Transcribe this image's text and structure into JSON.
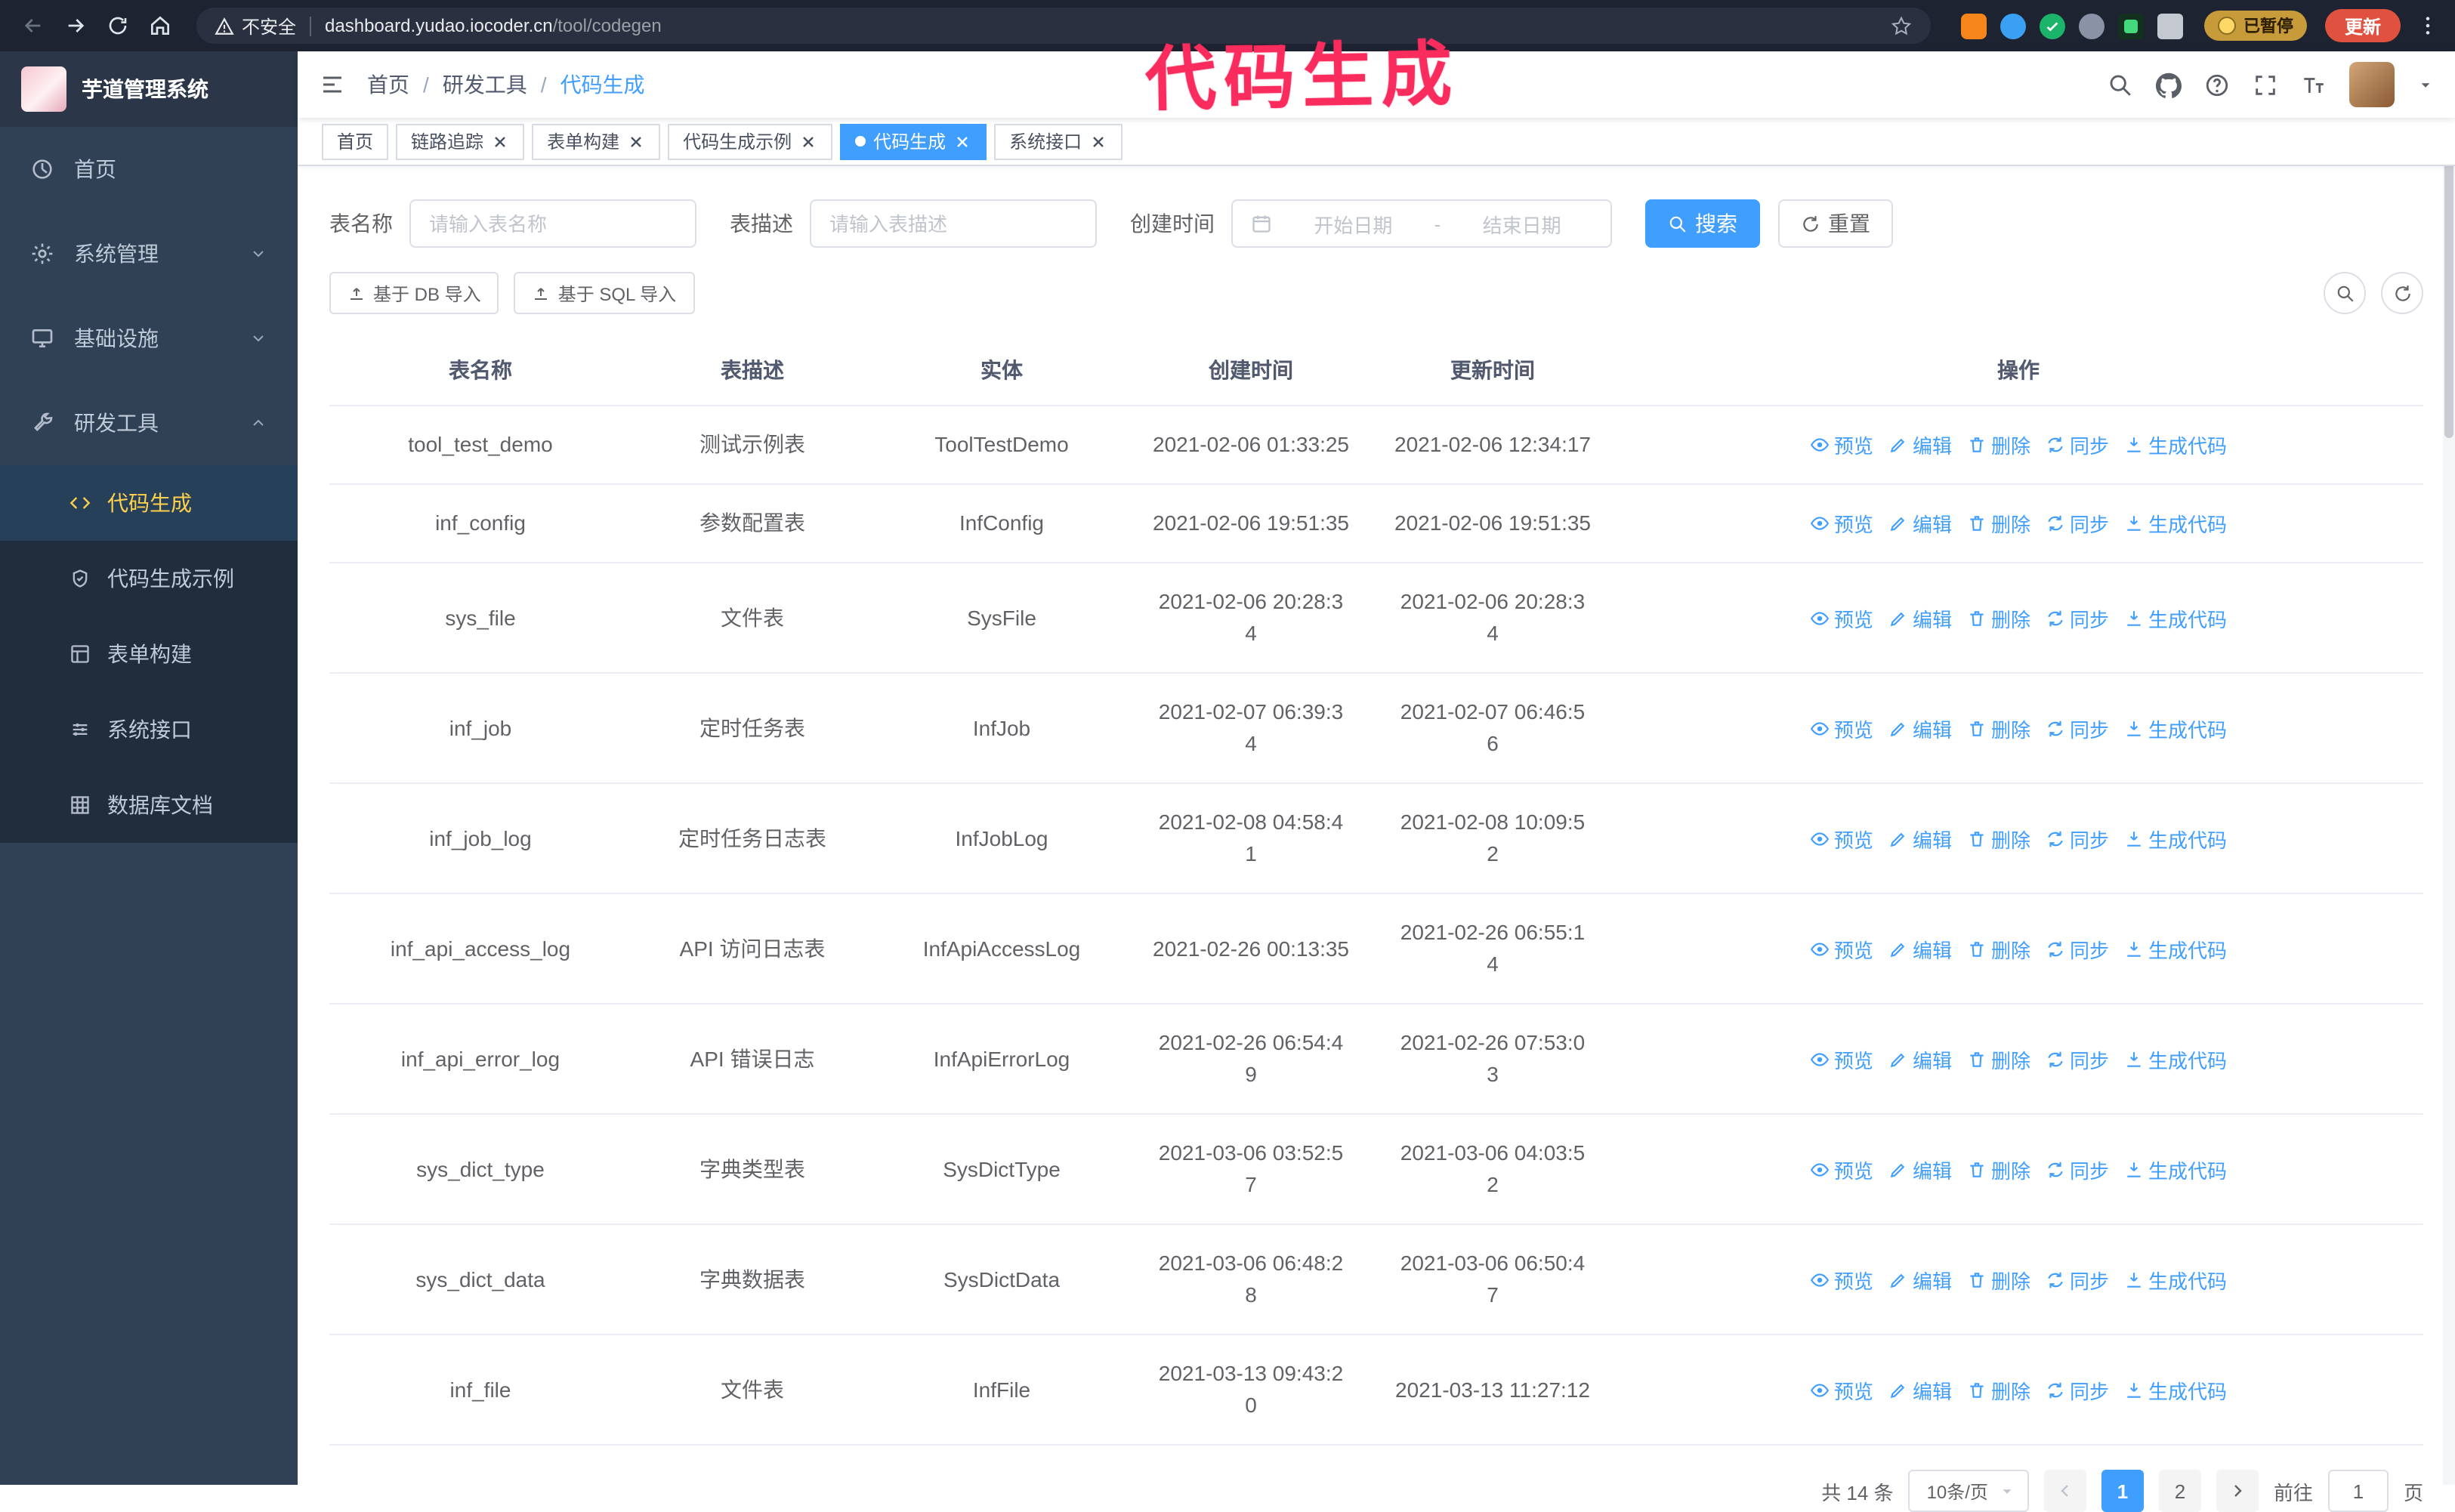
{
  "colors": {
    "accent": "#409eff",
    "sidebar_bg": "#304156",
    "submenu_bg": "#1f2d3d",
    "active_menu_text": "#ffd04b",
    "annotation": "#fa2c5e",
    "update_button_bg": "#e0523f",
    "paused_badge_bg": "#c79a3a"
  },
  "browser": {
    "security_label": "不安全",
    "url_domain": "dashboard.yudao.iocoder.cn",
    "url_path": "/tool/codegen",
    "paused_badge": "已暂停",
    "update_button": "更新"
  },
  "annotation": {
    "text": "代码生成"
  },
  "sidebar": {
    "logo_title": "芋道管理系统",
    "items": [
      {
        "label": "首页"
      },
      {
        "label": "系统管理"
      },
      {
        "label": "基础设施"
      },
      {
        "label": "研发工具",
        "expanded": true
      }
    ],
    "sub_items": [
      {
        "label": "代码生成",
        "active": true
      },
      {
        "label": "代码生成示例"
      },
      {
        "label": "表单构建"
      },
      {
        "label": "系统接口"
      },
      {
        "label": "数据库文档"
      }
    ]
  },
  "header": {
    "breadcrumb": [
      "首页",
      "研发工具",
      "代码生成"
    ],
    "breadcrumb_separator": "/"
  },
  "tabs": [
    {
      "label": "首页",
      "closable": false
    },
    {
      "label": "链路追踪",
      "closable": true
    },
    {
      "label": "表单构建",
      "closable": true
    },
    {
      "label": "代码生成示例",
      "closable": true
    },
    {
      "label": "代码生成",
      "closable": true,
      "active": true
    },
    {
      "label": "系统接口",
      "closable": true
    }
  ],
  "filters": {
    "table_name_label": "表名称",
    "table_name_placeholder": "请输入表名称",
    "table_desc_label": "表描述",
    "table_desc_placeholder": "请输入表描述",
    "create_time_label": "创建时间",
    "date_start_placeholder": "开始日期",
    "date_separator": "-",
    "date_end_placeholder": "结束日期",
    "search_button": "搜索",
    "reset_button": "重置"
  },
  "toolbar": {
    "import_db_button": "基于 DB 导入",
    "import_sql_button": "基于 SQL 导入"
  },
  "table": {
    "columns": [
      "表名称",
      "表描述",
      "实体",
      "创建时间",
      "更新时间",
      "操作"
    ],
    "rows": [
      {
        "name": "tool_test_demo",
        "desc": "测试示例表",
        "entity": "ToolTestDemo",
        "created": "2021-02-06 01:33:25",
        "updated": "2021-02-06 12:34:17"
      },
      {
        "name": "inf_config",
        "desc": "参数配置表",
        "entity": "InfConfig",
        "created": "2021-02-06 19:51:35",
        "updated": "2021-02-06 19:51:35"
      },
      {
        "name": "sys_file",
        "desc": "文件表",
        "entity": "SysFile",
        "created": "2021-02-06 20:28:34",
        "updated": "2021-02-06 20:28:34"
      },
      {
        "name": "inf_job",
        "desc": "定时任务表",
        "entity": "InfJob",
        "created": "2021-02-07 06:39:34",
        "updated": "2021-02-07 06:46:56"
      },
      {
        "name": "inf_job_log",
        "desc": "定时任务日志表",
        "entity": "InfJobLog",
        "created": "2021-02-08 04:58:41",
        "updated": "2021-02-08 10:09:52"
      },
      {
        "name": "inf_api_access_log",
        "desc": "API 访问日志表",
        "entity": "InfApiAccessLog",
        "created": "2021-02-26 00:13:35",
        "updated": "2021-02-26 06:55:14"
      },
      {
        "name": "inf_api_error_log",
        "desc": "API 错误日志",
        "entity": "InfApiErrorLog",
        "created": "2021-02-26 06:54:49",
        "updated": "2021-02-26 07:53:03"
      },
      {
        "name": "sys_dict_type",
        "desc": "字典类型表",
        "entity": "SysDictType",
        "created": "2021-03-06 03:52:57",
        "updated": "2021-03-06 04:03:52"
      },
      {
        "name": "sys_dict_data",
        "desc": "字典数据表",
        "entity": "SysDictData",
        "created": "2021-03-06 06:48:28",
        "updated": "2021-03-06 06:50:47"
      },
      {
        "name": "inf_file",
        "desc": "文件表",
        "entity": "InfFile",
        "created": "2021-03-13 09:43:20",
        "updated": "2021-03-13 11:27:12"
      }
    ]
  },
  "ops": {
    "preview": "预览",
    "edit": "编辑",
    "delete": "删除",
    "sync": "同步",
    "generate": "生成代码"
  },
  "pagination": {
    "total": "共 14 条",
    "page_size": "10条/页",
    "pages": [
      "1",
      "2"
    ],
    "current_page": "1",
    "goto_label": "前往",
    "goto_value": "1",
    "goto_suffix": "页"
  }
}
